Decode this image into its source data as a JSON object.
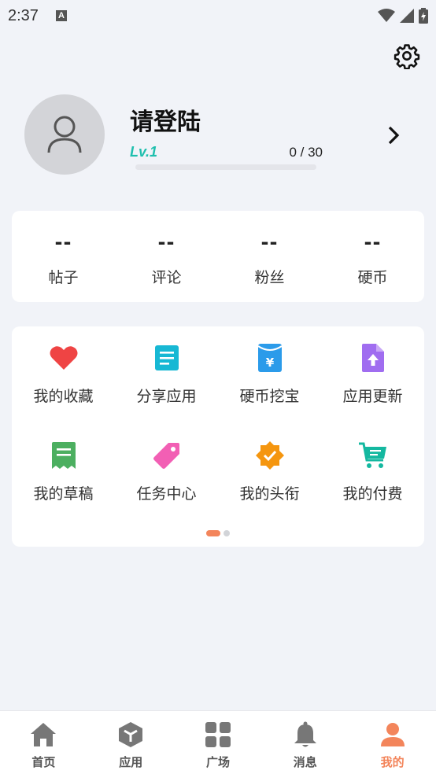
{
  "status_bar": {
    "time": "2:37",
    "notification_letter": "A"
  },
  "profile": {
    "username": "请登陆",
    "level": "Lv.1",
    "progress_text": "0 / 30",
    "progress_fraction": 0
  },
  "stats": [
    {
      "value": "--",
      "label": "帖子"
    },
    {
      "value": "--",
      "label": "评论"
    },
    {
      "value": "--",
      "label": "粉丝"
    },
    {
      "value": "--",
      "label": "硬币"
    }
  ],
  "menu": {
    "items": [
      {
        "label": "我的收藏",
        "icon": "heart-icon",
        "color": "#ef4444"
      },
      {
        "label": "分享应用",
        "icon": "document-list-icon",
        "color": "#17b8d4"
      },
      {
        "label": "硬币挖宝",
        "icon": "yen-envelope-icon",
        "color": "#2b9bea"
      },
      {
        "label": "应用更新",
        "icon": "file-upload-icon",
        "color": "#a06df0"
      },
      {
        "label": "我的草稿",
        "icon": "receipt-icon",
        "color": "#4caf60"
      },
      {
        "label": "任务中心",
        "icon": "tag-icon",
        "color": "#f25fb4"
      },
      {
        "label": "我的头衔",
        "icon": "badge-check-icon",
        "color": "#f5960f"
      },
      {
        "label": "我的付费",
        "icon": "cart-icon",
        "color": "#14b8a0"
      }
    ],
    "page_count": 2,
    "active_page": 0
  },
  "bottom_nav": {
    "items": [
      {
        "label": "首页",
        "icon": "home-icon"
      },
      {
        "label": "应用",
        "icon": "cube-icon"
      },
      {
        "label": "广场",
        "icon": "grid-icon"
      },
      {
        "label": "消息",
        "icon": "bell-icon"
      },
      {
        "label": "我的",
        "icon": "person-icon"
      }
    ],
    "active_index": 4
  },
  "colors": {
    "accent": "#f3855b",
    "level": "#1fbfae",
    "background": "#f1f3f8"
  }
}
